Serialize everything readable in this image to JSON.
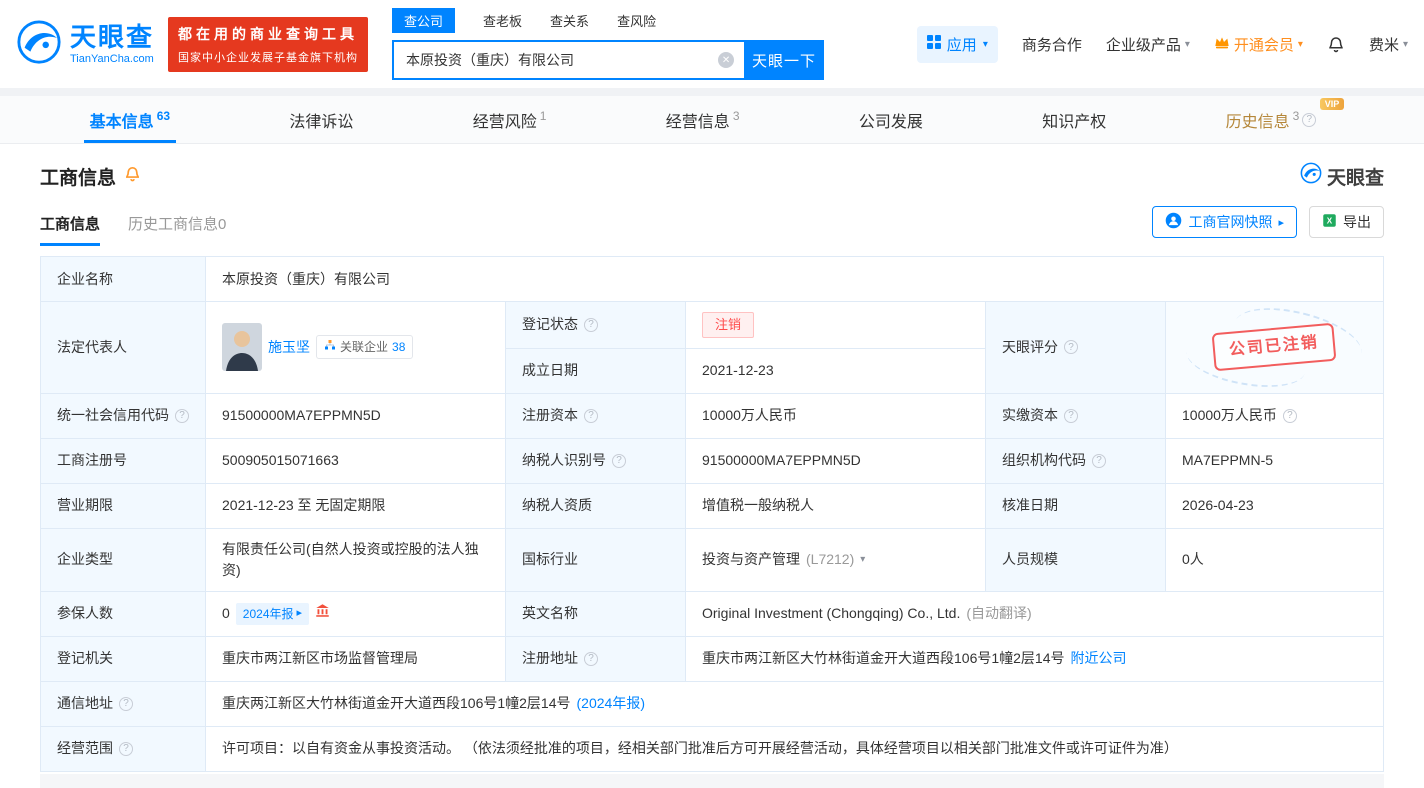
{
  "colors": {
    "accent_blue": "#0084ff",
    "brand_red": "#e5391f",
    "vip_orange": "#ff8f1f",
    "status_red": "#ff4b4b",
    "history_gold": "#b5873a"
  },
  "header": {
    "logo_title": "天眼查",
    "logo_subtitle": "TianYanCha.com",
    "slogan_line1": "都在用的商业查询工具",
    "slogan_line2": "国家中小企业发展子基金旗下机构",
    "search": {
      "tabs": [
        {
          "label": "查公司"
        },
        {
          "label": "查老板"
        },
        {
          "label": "查关系"
        },
        {
          "label": "查风险"
        }
      ],
      "value": "本原投资（重庆）有限公司",
      "button_label": "天眼一下"
    },
    "menu": {
      "apps_label": "应用",
      "cooperation_label": "商务合作",
      "enterprise_label": "企业级产品",
      "vip_label": "开通会员",
      "user_label": "费米"
    }
  },
  "nav_tabs": [
    {
      "label": "基本信息",
      "count": "63"
    },
    {
      "label": "法律诉讼",
      "count": ""
    },
    {
      "label": "经营风险",
      "count": "1"
    },
    {
      "label": "经营信息",
      "count": "3"
    },
    {
      "label": "公司发展",
      "count": ""
    },
    {
      "label": "知识产权",
      "count": ""
    },
    {
      "label": "历史信息",
      "count": "3",
      "vip_tag": "VIP"
    }
  ],
  "section": {
    "title": "工商信息",
    "brand": "天眼查",
    "subtab_active": "工商信息",
    "subtab_history": "历史工商信息0",
    "snapshot_button": "工商官网快照",
    "export_button": "导出"
  },
  "info": {
    "company_name_label": "企业名称",
    "company_name": "本原投资（重庆）有限公司",
    "legal_rep_label": "法定代表人",
    "legal_rep_name": "施玉坚",
    "related_companies_label": "关联企业",
    "related_companies_count": "38",
    "reg_status_label": "登记状态",
    "reg_status": "注销",
    "establish_date_label": "成立日期",
    "establish_date": "2021-12-23",
    "score_label": "天眼评分",
    "stamp_text": "公司已注销",
    "credit_code_label": "统一社会信用代码",
    "credit_code": "91500000MA7EPPMN5D",
    "reg_capital_label": "注册资本",
    "reg_capital": "10000万人民币",
    "paid_capital_label": "实缴资本",
    "paid_capital": "10000万人民币",
    "reg_number_label": "工商注册号",
    "reg_number": "500905015071663",
    "taxpayer_id_label": "纳税人识别号",
    "taxpayer_id": "91500000MA7EPPMN5D",
    "org_code_label": "组织机构代码",
    "org_code": "MA7EPPMN-5",
    "business_term_label": "营业期限",
    "business_term": "2021-12-23 至 无固定期限",
    "taxpayer_quality_label": "纳税人资质",
    "taxpayer_quality": "增值税一般纳税人",
    "approval_date_label": "核准日期",
    "approval_date": "2026-04-23",
    "company_type_label": "企业类型",
    "company_type": "有限责任公司(自然人投资或控股的法人独资)",
    "industry_label": "国标行业",
    "industry": "投资与资产管理",
    "industry_code": "(L7212)",
    "staff_size_label": "人员规模",
    "staff_size": "0人",
    "insured_label": "参保人数",
    "insured_count": "0",
    "insured_report_tag": "2024年报",
    "english_name_label": "英文名称",
    "english_name": "Original Investment (Chongqing) Co., Ltd.",
    "english_name_note": "(自动翻译)",
    "authority_label": "登记机关",
    "authority": "重庆市两江新区市场监督管理局",
    "reg_address_label": "注册地址",
    "reg_address": "重庆市两江新区大竹林街道金开大道西段106号1幢2层14号",
    "nearby_link": "附近公司",
    "mail_address_label": "通信地址",
    "mail_address": "重庆两江新区大竹林街道金开大道西段106号1幢2层14号",
    "mail_report_link": "(2024年报)",
    "business_scope_label": "经营范围",
    "business_scope": "许可项目：以自有资金从事投资活动。 （依法须经批准的项目，经相关部门批准后方可开展经营活动，具体经营项目以相关部门批准文件或许可证件为准）"
  }
}
